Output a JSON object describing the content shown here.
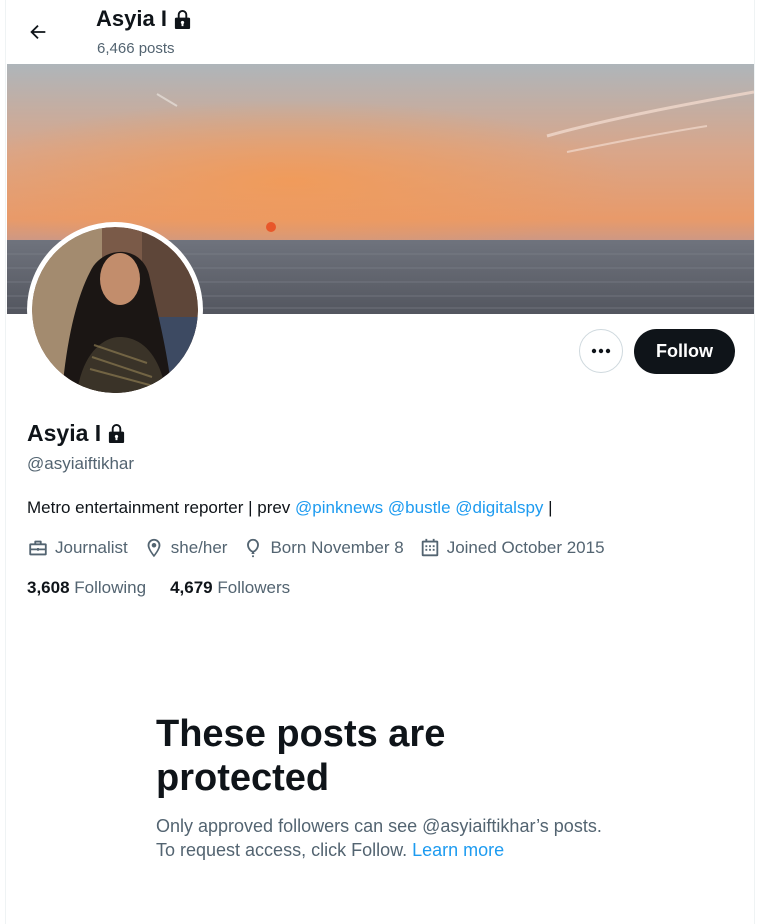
{
  "header": {
    "title": "Asyia I",
    "posts_count": "6,466 posts"
  },
  "profile": {
    "display_name": "Asyia I",
    "handle": "@asyiaiftikhar",
    "bio_text": "Metro entertainment reporter | prev",
    "bio_links": [
      "@pinknews",
      "@bustle",
      "@digitalspy"
    ],
    "bio_tail": "|",
    "occupation": "Journalist",
    "pronouns": "she/her",
    "birthday": "Born November 8",
    "joined": "Joined October 2015"
  },
  "stats": {
    "following_count": "3,608",
    "following_label": "Following",
    "followers_count": "4,679",
    "followers_label": "Followers"
  },
  "actions": {
    "follow_label": "Follow"
  },
  "protected": {
    "heading": "These posts are protected",
    "message": "Only approved followers can see @asyiaiftikhar’s posts. To request access, click Follow.",
    "learn_more": "Learn more"
  },
  "icons": {
    "back": "arrow-left-icon",
    "lock": "lock-icon",
    "more": "more-horizontal-icon",
    "occupation": "briefcase-icon",
    "location": "location-pin-icon",
    "birthday": "balloon-icon",
    "joined": "calendar-icon"
  },
  "colors": {
    "accent": "#1d9bf0",
    "text": "#0f1419",
    "secondary_text": "#536471",
    "button": "#0f1419"
  }
}
